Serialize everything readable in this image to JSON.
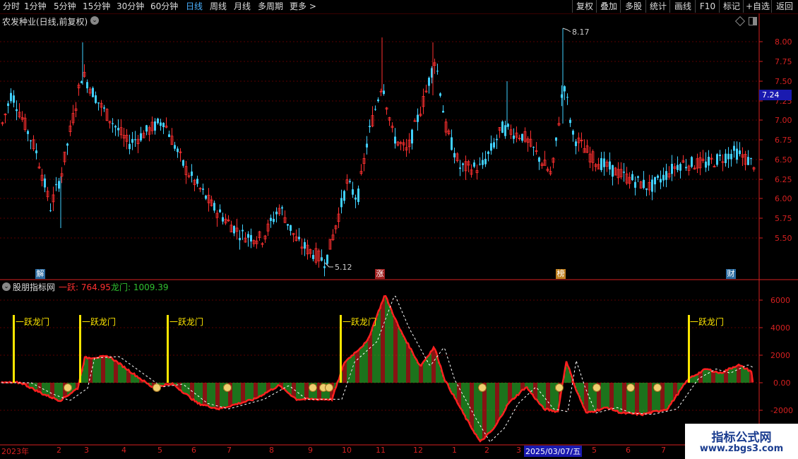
{
  "toolbar": {
    "periods": [
      "分时",
      "1分钟",
      "5分钟",
      "15分钟",
      "30分钟",
      "60分钟",
      "日线",
      "周线",
      "月线",
      "多周期",
      "更多 >"
    ],
    "active_period": "日线",
    "right_buttons": [
      "复权",
      "叠加",
      "多股",
      "统计",
      "画线",
      "F10",
      "标记",
      "+自选",
      "返回"
    ]
  },
  "main_chart": {
    "title": "农发种业(日线,前复权)",
    "price_axis": [
      "8.00",
      "7.75",
      "7.50",
      "7.25",
      "7.00",
      "6.75",
      "6.50",
      "6.25",
      "6.00",
      "5.75",
      "5.50"
    ],
    "current_price": "7.24",
    "high_label": "8.17",
    "low_label": "5.12",
    "events": [
      "解",
      "涨",
      "榜",
      "财"
    ],
    "colors": {
      "up": "#ff3030",
      "down": "#40d0ff",
      "grid": "#5a0000",
      "axis": "#d62020"
    }
  },
  "indicator": {
    "name": "股朋指标网",
    "line1_label": "一跃: 764.95",
    "line2_label": "龙门: 1009.39",
    "axis": [
      "6000",
      "4000",
      "2000",
      "0.00",
      "-2000"
    ],
    "signal_text": "一跃龙门",
    "colors": {
      "line1": "#ff2020",
      "line2": "#ffffff",
      "bar_pos": "#e02020",
      "bar_neg": "#30c030",
      "signal": "#ffe600"
    }
  },
  "date_axis": [
    "2023年",
    "2",
    "3",
    "4",
    "5",
    "6",
    "7",
    "8",
    "9",
    "10",
    "11",
    "12",
    "1",
    "2",
    "3",
    "2025/03/07/五",
    "5",
    "6",
    "7"
  ],
  "watermark": {
    "title": "指标公式网",
    "url": "www.zbgs3.com"
  }
}
